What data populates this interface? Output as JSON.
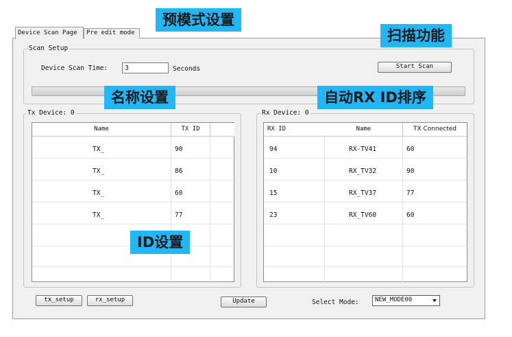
{
  "tabs": [
    {
      "label": "Device Scan Page",
      "active": true
    },
    {
      "label": "Pre edit mode",
      "active": false
    }
  ],
  "scan_setup": {
    "legend": "Scan Setup",
    "time_label": "Device Scan Time:",
    "time_value": "3",
    "unit": "Seconds",
    "start_button": "Start Scan"
  },
  "tx": {
    "legend": "Tx Device: 0",
    "columns": [
      "Name",
      "TX ID"
    ],
    "rows": [
      {
        "name": "TX_",
        "id": "90"
      },
      {
        "name": "TX_",
        "id": "86"
      },
      {
        "name": "TX_",
        "id": "60"
      },
      {
        "name": "TX_",
        "id": "77"
      }
    ]
  },
  "rx": {
    "legend": "Rx Device: 0",
    "columns": [
      "RX ID",
      "Name",
      "TX Connected"
    ],
    "rows": [
      {
        "id": "94",
        "name": "RX-TV41",
        "tx": "60"
      },
      {
        "id": "10",
        "name": "RX_TV32",
        "tx": "90"
      },
      {
        "id": "15",
        "name": "RX_TV37",
        "tx": "77"
      },
      {
        "id": "23",
        "name": "RX_TV60",
        "tx": "60"
      }
    ]
  },
  "footer": {
    "tx_setup": "tx_setup",
    "rx_setup": "rx_setup",
    "update": "Update",
    "select_mode_label": "Select Mode:",
    "select_mode_value": "NEW_MODE00"
  },
  "annotations": {
    "pre_mode": "预模式设置",
    "scan_func": "扫描功能",
    "name_setting": "名称设置",
    "auto_sort": "自动RX ID排序",
    "id_setting": "ID设置"
  },
  "colors": {
    "callout": "#1fb7f5"
  }
}
